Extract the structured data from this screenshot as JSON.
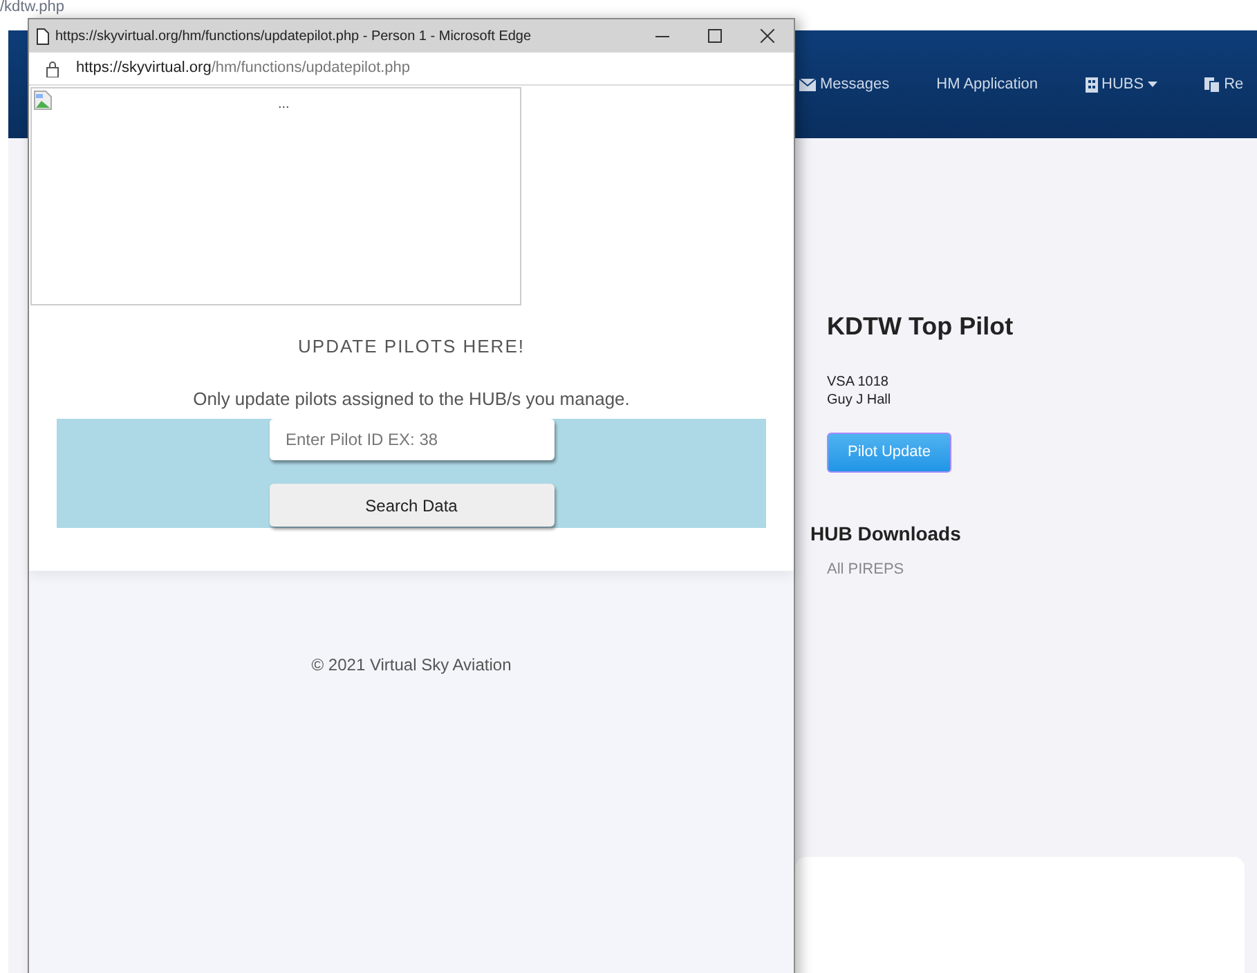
{
  "background_page": {
    "url_fragment": "/kdtw.php",
    "nav": [
      {
        "label": "Messages",
        "dropdown": false
      },
      {
        "label": "HM Application",
        "dropdown": false
      },
      {
        "label": "HUBS",
        "dropdown": true
      },
      {
        "label": "Re",
        "dropdown": false
      }
    ],
    "top_pilot": {
      "title": "KDTW Top Pilot",
      "pilot_id": "VSA 1018",
      "pilot_name": "Guy J Hall",
      "button": "Pilot Update"
    },
    "hub_downloads": {
      "title": "HUB Downloads",
      "links": [
        "All PIREPS"
      ]
    }
  },
  "popup": {
    "title": "https://skyvirtual.org/hm/functions/updatepilot.php - Person 1 - Microsoft Edge",
    "url": {
      "host": "https://skyvirtual.org",
      "path": "/hm/functions/updatepilot.php"
    },
    "image_alt": "...",
    "heading": "UPDATE PILOTS HERE!",
    "instruction": "Only update pilots assigned to the HUB/s you manage.",
    "search": {
      "placeholder": "Enter Pilot ID EX: 38",
      "button": "Search Data"
    },
    "footer": "© 2021 Virtual Sky Aviation"
  }
}
